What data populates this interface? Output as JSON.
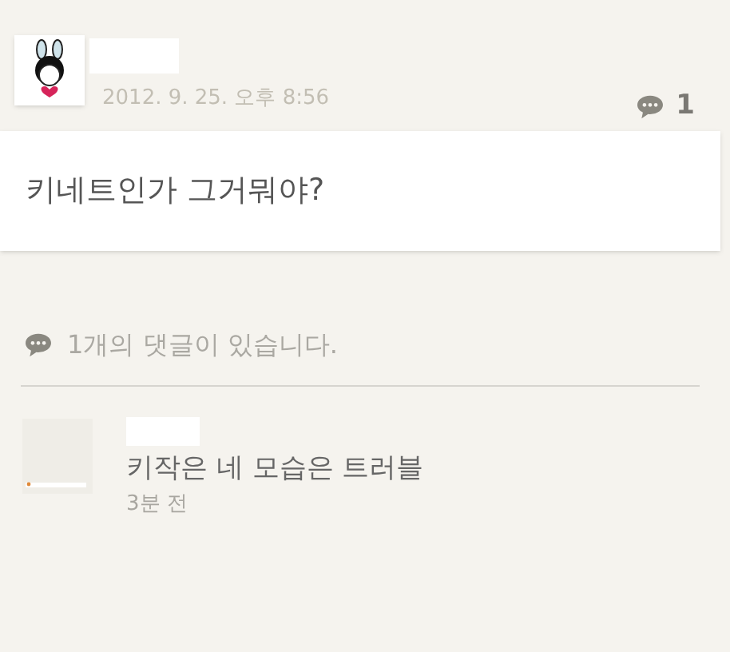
{
  "post": {
    "date": "2012. 9. 25. 오후 8:56",
    "comment_count": "1",
    "body": "키네트인가 그거뭐야?"
  },
  "comments_header": "1개의 댓글이 있습니다.",
  "comments": [
    {
      "text": "키작은 네 모습은 트러블",
      "time": "3분 전"
    }
  ]
}
